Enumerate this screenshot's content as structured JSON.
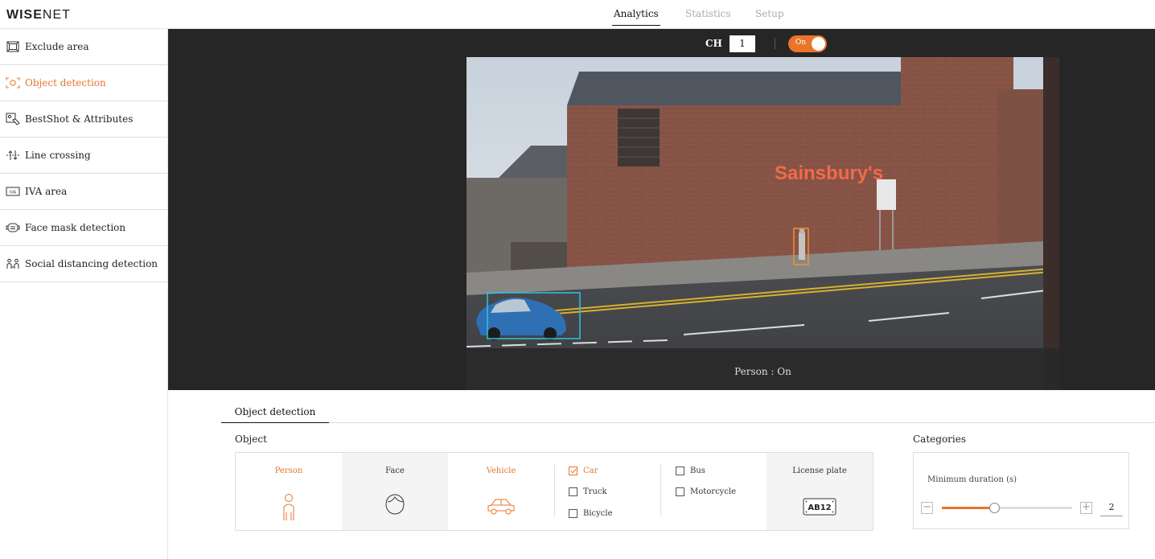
{
  "app": {
    "logo_bold": "WISE",
    "logo_light": "NET"
  },
  "topnav": {
    "tabs": [
      {
        "label": "Analytics",
        "active": true
      },
      {
        "label": "Statistics",
        "active": false
      },
      {
        "label": "Setup",
        "active": false
      }
    ]
  },
  "sidebar": {
    "items": [
      {
        "label": "Exclude area",
        "icon": "exclude-area-icon"
      },
      {
        "label": "Object detection",
        "icon": "object-detection-icon",
        "active": true
      },
      {
        "label": "BestShot & Attributes",
        "icon": "bestshot-icon"
      },
      {
        "label": "Line crossing",
        "icon": "line-crossing-icon"
      },
      {
        "label": "IVA area",
        "icon": "iva-area-icon"
      },
      {
        "label": "Face mask detection",
        "icon": "face-mask-icon"
      },
      {
        "label": "Social distancing detection",
        "icon": "social-distancing-icon"
      }
    ]
  },
  "video": {
    "channel_label": "CH",
    "channel_value": "1",
    "toggle_label": "On",
    "store_sign": "Sainsbury's",
    "overlay_text": "Person : On"
  },
  "config": {
    "tab_label": "Object detection",
    "object_section": "Object",
    "categories_section": "Categories",
    "objects": {
      "person": "Person",
      "face": "Face",
      "vehicle": "Vehicle",
      "license_plate": "License plate",
      "plate_text": "AB12"
    },
    "vehicle_types": [
      {
        "label": "Car",
        "checked": true
      },
      {
        "label": "Truck",
        "checked": false
      },
      {
        "label": "Bicycle",
        "checked": false
      },
      {
        "label": "Bus",
        "checked": false
      },
      {
        "label": "Motorcycle",
        "checked": false
      }
    ],
    "min_duration": {
      "label": "Minimum duration (s)",
      "value": "2",
      "slider_fraction": 0.4
    }
  },
  "colors": {
    "accent": "#e8752a",
    "detect_box_vehicle": "#2ec3e0",
    "detect_box_person": "#e8952a"
  }
}
